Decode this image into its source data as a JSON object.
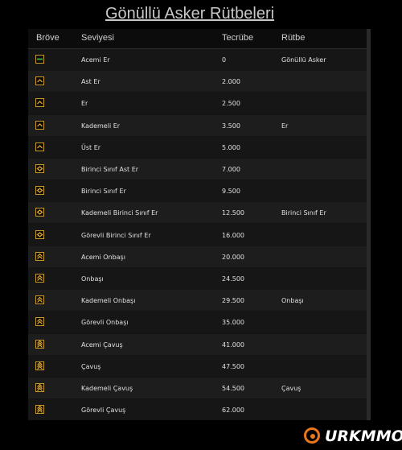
{
  "page": {
    "title": "Gönüllü Asker Rütbeleri"
  },
  "table": {
    "headers": {
      "badge": "Bröve",
      "level": "Seviyesi",
      "exp": "Tecrübe",
      "rank": "Rütbe"
    },
    "rows": [
      {
        "badge_icon": "green-bar-icon",
        "level": "Acemi Er",
        "exp": "0",
        "rank": "Gönüllü Asker"
      },
      {
        "badge_icon": "single-chevron-icon",
        "level": "Ast Er",
        "exp": "2.000",
        "rank": ""
      },
      {
        "badge_icon": "single-chevron-icon",
        "level": "Er",
        "exp": "2.500",
        "rank": ""
      },
      {
        "badge_icon": "single-chevron-icon",
        "level": "Kademeli Er",
        "exp": "3.500",
        "rank": "Er"
      },
      {
        "badge_icon": "single-chevron-icon",
        "level": "Üst Er",
        "exp": "5.000",
        "rank": ""
      },
      {
        "badge_icon": "diamond-icon",
        "level": "Birinci Sınıf Ast Er",
        "exp": "7.000",
        "rank": ""
      },
      {
        "badge_icon": "diamond-icon",
        "level": "Birinci Sınıf Er",
        "exp": "9.500",
        "rank": ""
      },
      {
        "badge_icon": "diamond-icon",
        "level": "Kademeli Birinci Sınıf Er",
        "exp": "12.500",
        "rank": "Birinci Sınıf Er"
      },
      {
        "badge_icon": "diamond-icon",
        "level": "Görevli Birinci Sınıf Er",
        "exp": "16.000",
        "rank": ""
      },
      {
        "badge_icon": "double-chevron-icon",
        "level": "Acemi Onbaşı",
        "exp": "20.000",
        "rank": ""
      },
      {
        "badge_icon": "double-chevron-icon",
        "level": "Onbaşı",
        "exp": "24.500",
        "rank": ""
      },
      {
        "badge_icon": "double-chevron-icon",
        "level": "Kademeli Onbaşı",
        "exp": "29.500",
        "rank": "Onbaşı"
      },
      {
        "badge_icon": "double-chevron-icon",
        "level": "Görevli Onbaşı",
        "exp": "35.000",
        "rank": ""
      },
      {
        "badge_icon": "triple-chevron-icon",
        "level": "Acemi Çavuş",
        "exp": "41.000",
        "rank": ""
      },
      {
        "badge_icon": "triple-chevron-icon",
        "level": "Çavuş",
        "exp": "47.500",
        "rank": ""
      },
      {
        "badge_icon": "triple-chevron-icon",
        "level": "Kademeli Çavuş",
        "exp": "54.500",
        "rank": "Çavuş"
      },
      {
        "badge_icon": "triple-chevron-icon",
        "level": "Görevli Çavuş",
        "exp": "62.000",
        "rank": ""
      }
    ]
  },
  "logo": {
    "text": "URKMMO",
    "icon": "turkmmo-ring-icon",
    "accent": "#e8761a"
  },
  "colors": {
    "badge_border": "#c89a2a",
    "badge_fill": "#e8b030",
    "badge_green": "#3fa03f"
  }
}
